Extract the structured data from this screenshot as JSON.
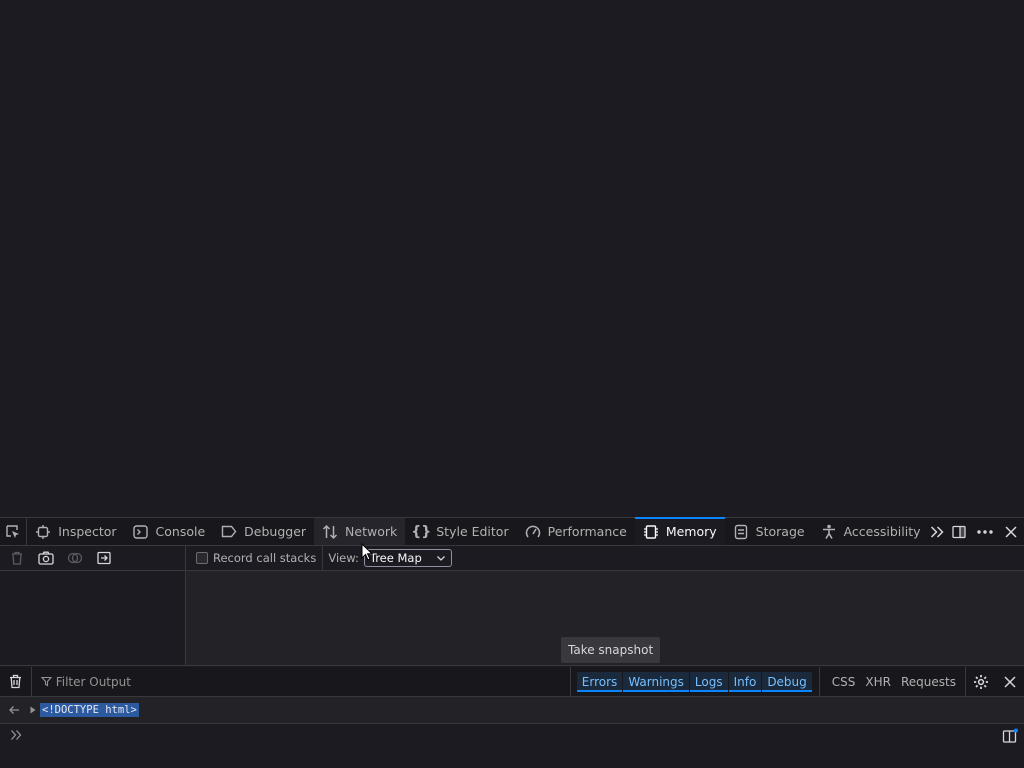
{
  "tabs": [
    {
      "label": "Inspector",
      "icon": "inspector-icon"
    },
    {
      "label": "Console",
      "icon": "console-icon"
    },
    {
      "label": "Debugger",
      "icon": "debugger-icon"
    },
    {
      "label": "Network",
      "icon": "network-icon"
    },
    {
      "label": "Style Editor",
      "icon": "style-editor-icon"
    },
    {
      "label": "Performance",
      "icon": "performance-icon"
    },
    {
      "label": "Memory",
      "icon": "memory-icon",
      "selected": true
    },
    {
      "label": "Storage",
      "icon": "storage-icon"
    },
    {
      "label": "Accessibility",
      "icon": "accessibility-icon"
    }
  ],
  "memory": {
    "record_call_stacks_label": "Record call stacks",
    "record_call_stacks_checked": false,
    "view_label": "View:",
    "view_value": "Tree Map",
    "take_snapshot_label": "Take snapshot"
  },
  "console": {
    "filter_placeholder": "Filter Output",
    "levels": [
      "Errors",
      "Warnings",
      "Logs",
      "Info",
      "Debug"
    ],
    "types": [
      "CSS",
      "XHR",
      "Requests"
    ],
    "output_text": "<!DOCTYPE html>"
  },
  "colors": {
    "accent": "#0a84ff",
    "toolbar_bg": "#18181c",
    "panel_bg": "#1c1b22",
    "level_text": "#75bfff"
  }
}
